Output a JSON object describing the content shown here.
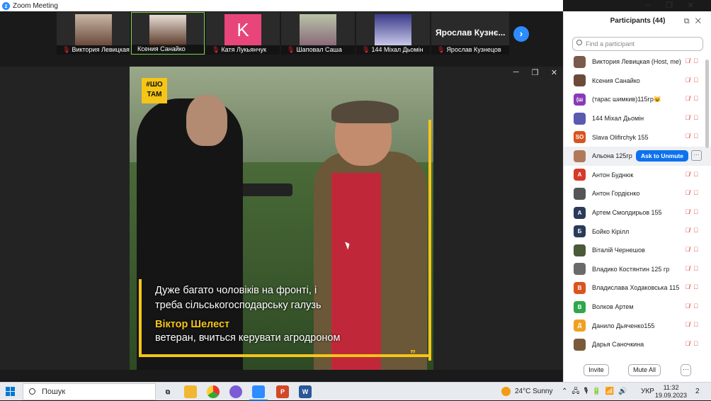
{
  "window": {
    "title": "Zoom Meeting",
    "controls": {
      "minimize": "─",
      "maximize": "❐",
      "close": "✕"
    }
  },
  "thumbnails": [
    {
      "name": "Виктория Левицкая",
      "muted": true
    },
    {
      "name": "Ксения Санайко",
      "muted": false
    },
    {
      "name": "Катя Лукьянчук",
      "muted": true,
      "initial": "K"
    },
    {
      "name": "Шаповал Саша",
      "muted": true
    },
    {
      "name": "144 Міхал Дьомін",
      "muted": true
    },
    {
      "name": "Ярослав Кузнецов",
      "muted": true,
      "display": "Ярослав  Кузнє..."
    }
  ],
  "video": {
    "badge": "#ШО ТАМ",
    "subtitle_line1": "Дуже багато чоловіків на фронті, і",
    "subtitle_line2": "треба сільськогосподарську галузь",
    "speaker_name": "Віктор Шелест",
    "speaker_desc": "ветеран, вчиться керувати агродроном",
    "quote": "”"
  },
  "participants": {
    "header": "Participants (44)",
    "search_placeholder": "Find a participant",
    "ask_to_unmute": "Ask to Unmute",
    "more": "···",
    "list": [
      {
        "name": "Виктория Левицкая (Host, me)",
        "avatar": "",
        "color": "#7a5a4a"
      },
      {
        "name": "Ксения Санайко",
        "avatar": "",
        "color": "#6b4a3a"
      },
      {
        "name": "(тарас шимкив)115гр😺",
        "avatar": "(ш",
        "color": "#8a3ab8"
      },
      {
        "name": "144 Міхал Дьомін",
        "avatar": "",
        "color": "#5a5ab0"
      },
      {
        "name": "Slava Olifirchyk 155",
        "avatar": "SO",
        "color": "#d9541e"
      },
      {
        "name": "Альона 125гр",
        "avatar": "",
        "color": "#b07a5a"
      },
      {
        "name": "Антон Буднюк",
        "avatar": "A",
        "color": "#d63a2a"
      },
      {
        "name": "Антон Гордієнко",
        "avatar": "",
        "color": "#555555"
      },
      {
        "name": "Артем Смолдирьов 155",
        "avatar": "A",
        "color": "#2a3a5a"
      },
      {
        "name": "Бойко Кірілл",
        "avatar": "Б",
        "color": "#2a3a5a"
      },
      {
        "name": "Віталій Чернешов",
        "avatar": "",
        "color": "#4a5a3a"
      },
      {
        "name": "Владико Костянтин 125 гр",
        "avatar": "",
        "color": "#6a6a6a"
      },
      {
        "name": "Владислава Ходаковська 115",
        "avatar": "B",
        "color": "#d9541e"
      },
      {
        "name": "Волков Артем",
        "avatar": "B",
        "color": "#2ea84a"
      },
      {
        "name": "Данило Дьяченко155",
        "avatar": "Д",
        "color": "#f0a020"
      },
      {
        "name": "Дарья Саночкина",
        "avatar": "",
        "color": "#7a5a3a"
      }
    ],
    "invite": "Invite",
    "mute_all": "Mute All"
  },
  "taskbar": {
    "search": "Пошук",
    "weather": "24°C  Sunny",
    "lang": "УКР",
    "time": "11:32",
    "date": "19.09.2023",
    "notifications": "2"
  }
}
